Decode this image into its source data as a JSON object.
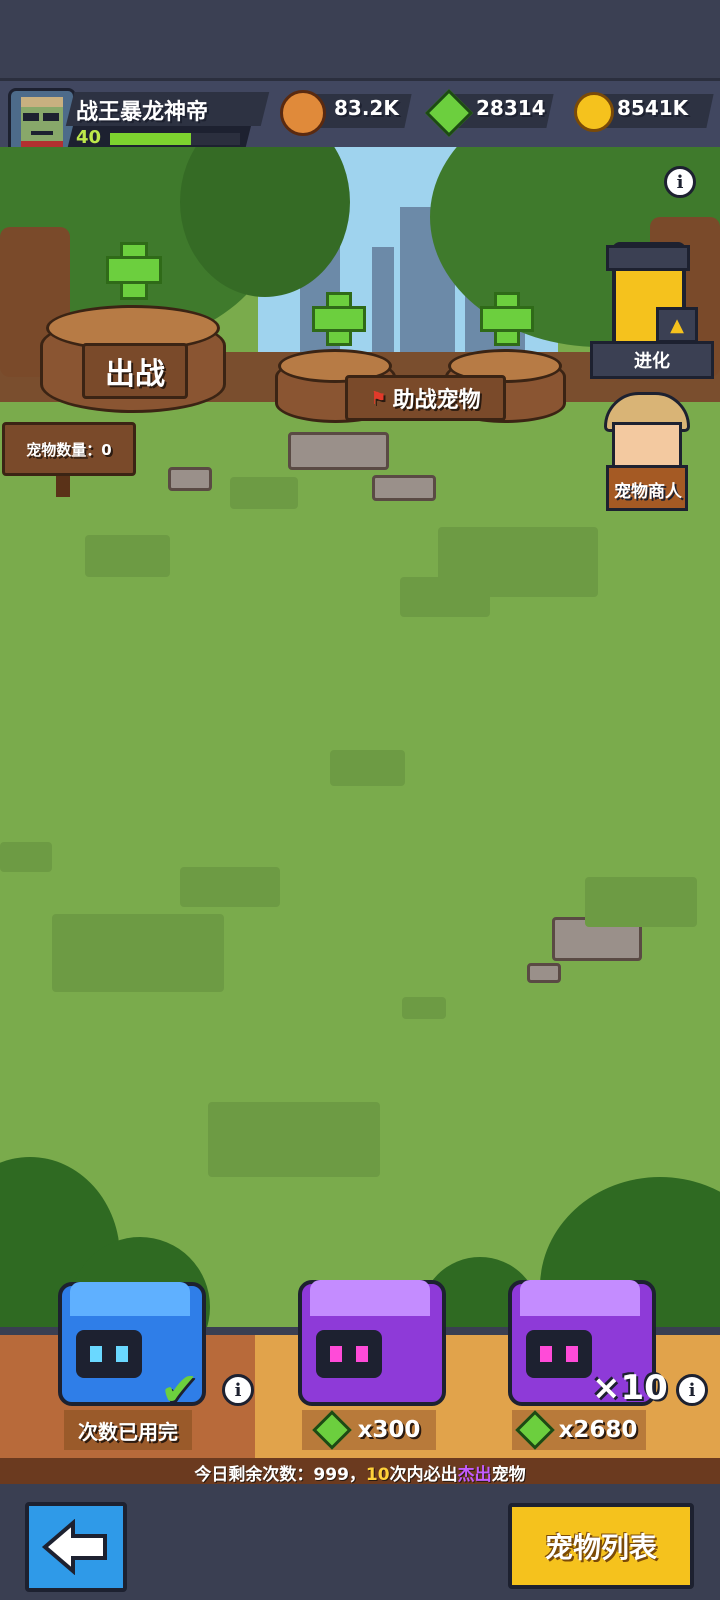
{
  "player": {
    "name": "战王暴龙神帝",
    "level": "40",
    "xp_fraction": 0.62
  },
  "resources": {
    "paws": "83.2K",
    "gems": "28314",
    "gold": "8541K"
  },
  "scene": {
    "deploy_label": "出战",
    "assist_label": "助战宠物",
    "pet_count_label": "宠物数量：0",
    "evolve_label": "进化",
    "merchant_label": "宠物商人",
    "info_symbol": "i"
  },
  "shop": {
    "free_chest_label": "次数已用完",
    "single_cost": "x300",
    "multi_count": "×10",
    "multi_cost": "x2680",
    "notice_prefix": "今日剩余次数：999，",
    "notice_count": "10",
    "notice_mid": "次内必出",
    "notice_rarity": "杰出",
    "notice_suffix": "宠物"
  },
  "nav": {
    "pet_list_label": "宠物列表"
  },
  "colors": {
    "accent_green": "#6ccf3e",
    "gold": "#f5c21d",
    "purple": "#8e3ad8",
    "blue": "#2f7ee8",
    "rarity": "#c45cff",
    "count": "#ffd23a"
  },
  "icons": [
    "back-arrow-icon",
    "check-icon",
    "info-icon",
    "gem-icon",
    "paw-coin-icon",
    "gold-coin-icon",
    "plus-icon",
    "flag-icon"
  ]
}
